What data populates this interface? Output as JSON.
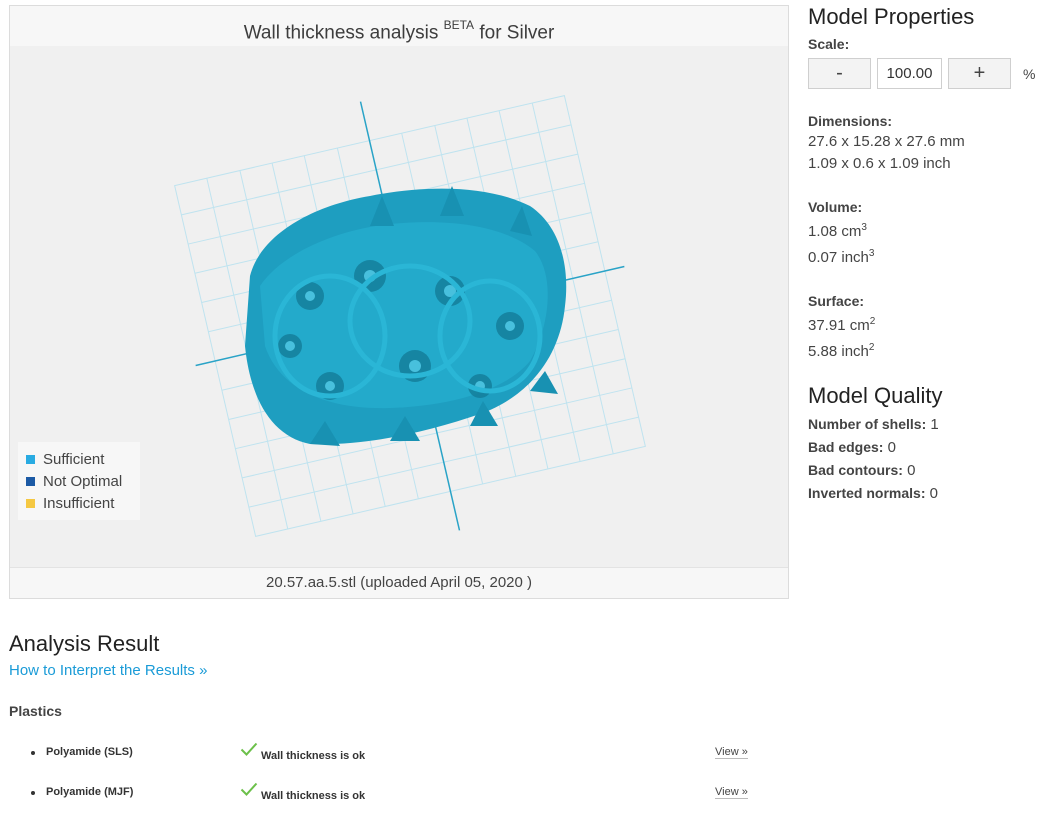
{
  "viewer": {
    "title_main": "Wall thickness analysis",
    "title_sup": "BETA",
    "title_tail": "for Silver",
    "footer": "20.57.aa.5.stl (uploaded April 05, 2020 )",
    "legend": [
      {
        "label": "Sufficient",
        "color": "#29abe2"
      },
      {
        "label": "Not Optimal",
        "color": "#1c5aa5"
      },
      {
        "label": "Insufficient",
        "color": "#f5c842"
      }
    ],
    "model_color": "#1e9ec0"
  },
  "properties": {
    "title": "Model Properties",
    "scale_label": "Scale:",
    "scale_minus": "-",
    "scale_value": "100.00",
    "scale_plus": "+",
    "scale_unit": "%",
    "dimensions_label": "Dimensions:",
    "dimensions_mm": "27.6 x 15.28 x 27.6 mm",
    "dimensions_inch": "1.09 x 0.6 x 1.09 inch",
    "volume_label": "Volume:",
    "volume_cm": "1.08 cm",
    "volume_inch": "0.07 inch",
    "volume_exp": "3",
    "surface_label": "Surface:",
    "surface_cm": "37.91 cm",
    "surface_inch": "5.88 inch",
    "surface_exp": "2"
  },
  "quality": {
    "title": "Model Quality",
    "rows": [
      {
        "label": "Number of shells:",
        "value": "1"
      },
      {
        "label": "Bad edges:",
        "value": "0"
      },
      {
        "label": "Bad contours:",
        "value": "0"
      },
      {
        "label": "Inverted normals:",
        "value": "0"
      }
    ]
  },
  "analysis": {
    "title": "Analysis Result",
    "link": "How to Interpret the Results »",
    "category": "Plastics",
    "results": [
      {
        "material": "Polyamide (SLS)",
        "status": "Wall thickness is ok",
        "view": "View »"
      },
      {
        "material": "Polyamide (MJF)",
        "status": "Wall thickness is ok",
        "view": "View »"
      }
    ]
  }
}
